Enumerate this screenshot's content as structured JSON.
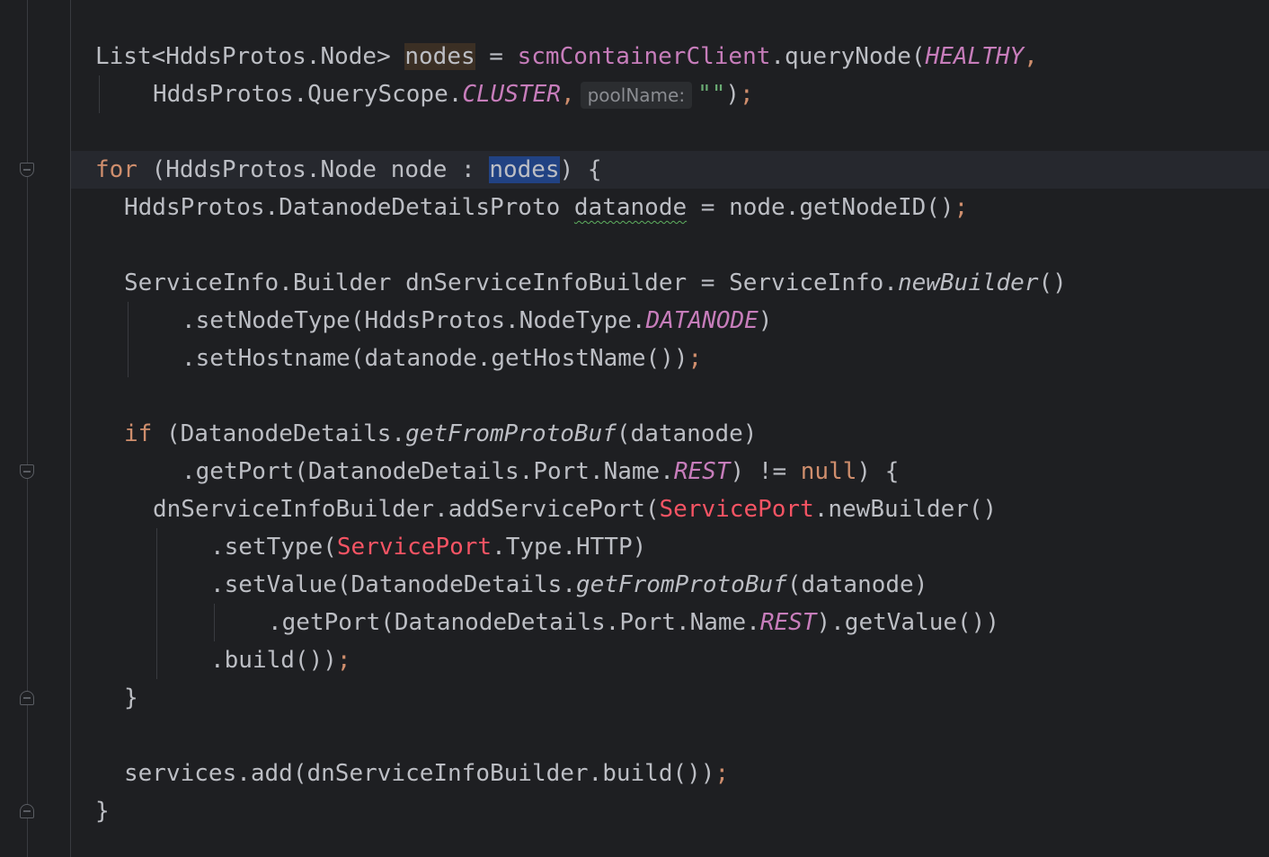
{
  "editor": {
    "param_hint": "poolName:",
    "lines": {
      "l1": {
        "a": "List<HddsProtos.Node> ",
        "b": "nodes",
        "c": " = ",
        "d": "scmContainerClient",
        "e": ".queryNode(",
        "f": "HEALTHY",
        "g": ","
      },
      "l2": {
        "a": "HddsProtos.QueryScope.",
        "b": "CLUSTER",
        "c": ",",
        "str": "\"\"",
        "e": ")",
        "f": ";"
      },
      "l3": {
        "a": "for",
        "b": " (HddsProtos.Node node : ",
        "c": "nodes",
        "d": ") {"
      },
      "l4": {
        "a": "HddsProtos.DatanodeDetailsProto ",
        "b": "datanode",
        "c": " = node.getNodeID()",
        "d": ";"
      },
      "l5": {
        "a": "ServiceInfo.Builder dnServiceInfoBuilder = ServiceInfo.",
        "b": "newBuilder",
        "c": "()"
      },
      "l6": {
        "a": ".setNodeType(HddsProtos.NodeType.",
        "b": "DATANODE",
        "c": ")"
      },
      "l7": {
        "a": ".setHostname(datanode.getHostName())",
        "b": ";"
      },
      "l8": {
        "a": "if",
        "b": " (DatanodeDetails.",
        "c": "getFromProtoBuf",
        "d": "(datanode)"
      },
      "l9": {
        "a": ".getPort(DatanodeDetails.Port.Name.",
        "b": "REST",
        "c": ") != ",
        "d": "null",
        "e": ") {"
      },
      "l10": {
        "a": "dnServiceInfoBuilder.addServicePort(",
        "b": "ServicePort",
        "c": ".newBuilder()"
      },
      "l11": {
        "a": ".setType(",
        "b": "ServicePort",
        "c": ".Type.HTTP)"
      },
      "l12": {
        "a": ".setValue(DatanodeDetails.",
        "b": "getFromProtoBuf",
        "c": "(datanode)"
      },
      "l13": {
        "a": ".getPort(DatanodeDetails.Port.Name.",
        "b": "REST",
        "c": ").getValue())"
      },
      "l14": {
        "a": ".build())",
        "b": ";"
      },
      "l15": {
        "a": "}"
      },
      "l16": {
        "a": "services.add(dnServiceInfoBuilder.build())",
        "b": ";"
      },
      "l17": {
        "a": "}"
      }
    }
  }
}
